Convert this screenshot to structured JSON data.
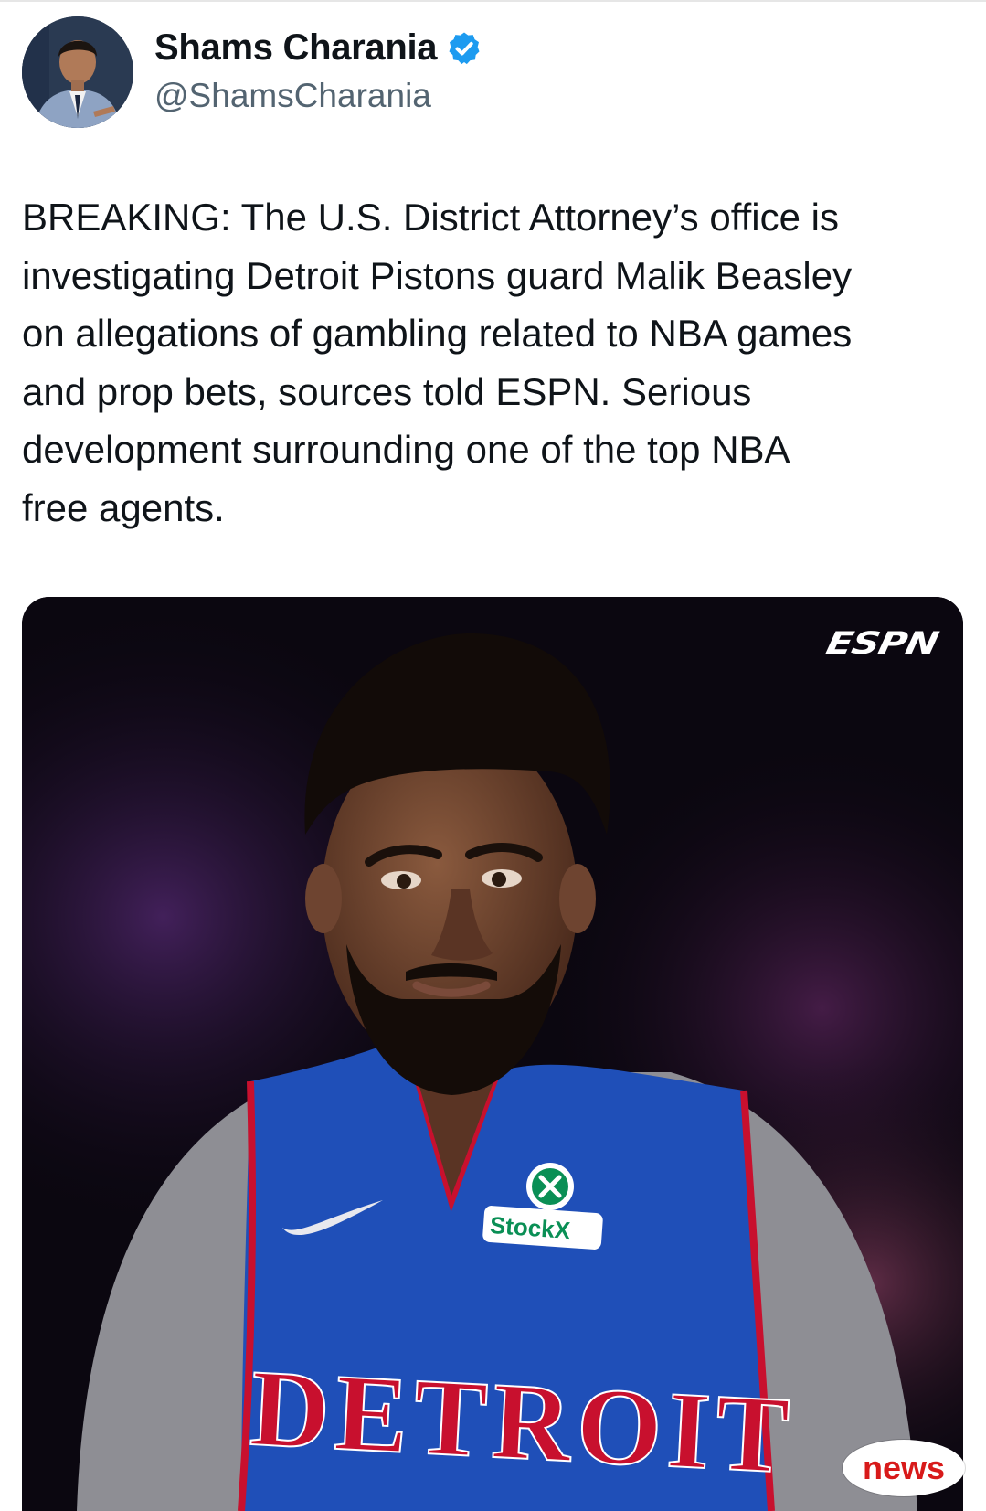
{
  "author": {
    "display_name": "Shams Charania",
    "handle": "@ShamsCharania",
    "verified": true
  },
  "tweet": {
    "text": "BREAKING: The U.S. District Attorney’s office is\ninvestigating Detroit Pistons guard Malik Beasley\non allegations of gambling related to NBA games\nand prop bets, sources told ESPN. Serious\ndevelopment surrounding one of the top NBA\nfree agents."
  },
  "media": {
    "logo_text": "ESPN",
    "jersey_text": "DETROIT",
    "sponsor_text": "StockX"
  },
  "badge": {
    "label": "news"
  },
  "colors": {
    "verified_blue": "#1d9bf0",
    "handle_gray": "#536471",
    "jersey_blue": "#1f4fb8",
    "jersey_red": "#c8102e",
    "badge_red": "#d81a1a"
  },
  "icons": {
    "verified": "verified-badge-icon"
  }
}
